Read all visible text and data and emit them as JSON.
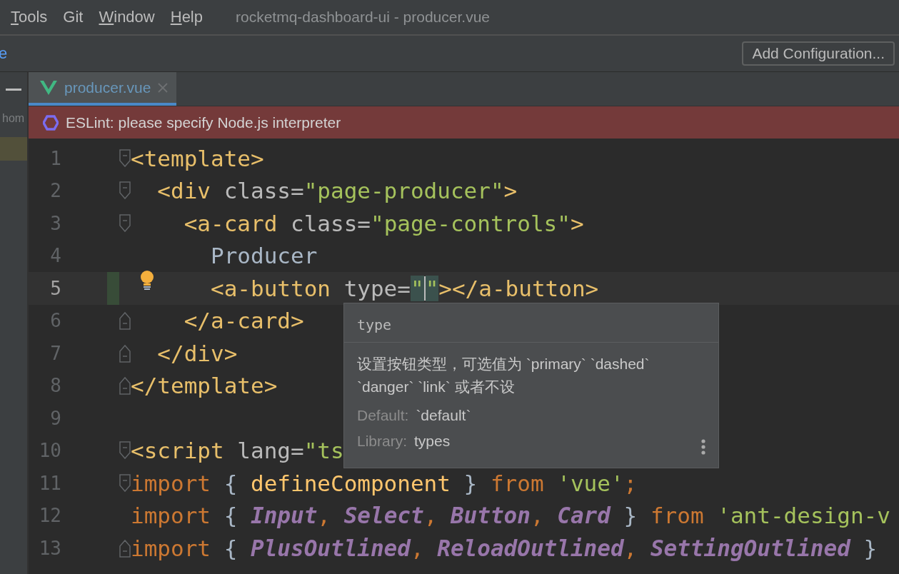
{
  "menu_bar": {
    "items": [
      {
        "label": "Tools",
        "underline_first": true
      },
      {
        "label": "Git",
        "underline_first": false
      },
      {
        "label": "Window",
        "underline_first": true
      },
      {
        "label": "Help",
        "underline_first": true
      }
    ],
    "title": "rocketmq-dashboard-ui - producer.vue"
  },
  "toolbar": {
    "breadcrumb": "e",
    "button": "Add Configuration..."
  },
  "side_panel": {
    "label": "hom"
  },
  "tabs": [
    {
      "label": "producer.vue",
      "selected": true
    }
  ],
  "banner": {
    "text": "ESLint: please specify Node.js interpreter"
  },
  "lines": [
    {
      "number": "1",
      "fold_start": true,
      "fold_end": false,
      "current": false,
      "changed": false,
      "bulb": false,
      "tokens": [
        {
          "text": "<template>",
          "kind": "tag"
        }
      ]
    },
    {
      "number": "2",
      "fold_start": true,
      "fold_end": false,
      "current": false,
      "changed": false,
      "bulb": false,
      "tokens": [
        {
          "text": "  <div",
          "kind": "tag"
        },
        {
          "text": " class=",
          "kind": "attr"
        },
        {
          "text": "\"page-producer\"",
          "kind": "string"
        },
        {
          "text": ">",
          "kind": "tag"
        }
      ]
    },
    {
      "number": "3",
      "fold_start": true,
      "fold_end": false,
      "current": false,
      "changed": false,
      "bulb": false,
      "tokens": [
        {
          "text": "    <a-card",
          "kind": "tag"
        },
        {
          "text": " class=",
          "kind": "attr"
        },
        {
          "text": "\"page-controls\"",
          "kind": "string"
        },
        {
          "text": ">",
          "kind": "tag"
        }
      ]
    },
    {
      "number": "4",
      "fold_start": false,
      "fold_end": false,
      "current": false,
      "changed": false,
      "bulb": false,
      "tokens": [
        {
          "text": "      Producer",
          "kind": "text"
        }
      ]
    },
    {
      "number": "5",
      "fold_start": false,
      "fold_end": false,
      "current": true,
      "changed": true,
      "bulb": true,
      "tokens": [
        {
          "text": "      <a-button",
          "kind": "tag"
        },
        {
          "text": " type=",
          "kind": "attr"
        },
        {
          "text": "\"",
          "kind": "string-match",
          "caret": true
        },
        {
          "text": "\"",
          "kind": "string-match",
          "caret": false
        },
        {
          "text": "></a-button>",
          "kind": "tag"
        }
      ]
    },
    {
      "number": "6",
      "fold_start": false,
      "fold_end": true,
      "current": false,
      "changed": false,
      "bulb": false,
      "tokens": [
        {
          "text": "    </a-card>",
          "kind": "tag"
        }
      ]
    },
    {
      "number": "7",
      "fold_start": false,
      "fold_end": true,
      "current": false,
      "changed": false,
      "bulb": false,
      "tokens": [
        {
          "text": "  </div>",
          "kind": "tag"
        }
      ]
    },
    {
      "number": "8",
      "fold_start": false,
      "fold_end": true,
      "current": false,
      "changed": false,
      "bulb": false,
      "tokens": [
        {
          "text": "</template>",
          "kind": "tag"
        }
      ]
    },
    {
      "number": "9",
      "fold_start": false,
      "fold_end": false,
      "current": false,
      "changed": false,
      "bulb": false
    },
    {
      "number": "10",
      "fold_start": true,
      "fold_end": false,
      "current": false,
      "changed": false,
      "bulb": false,
      "tokens": [
        {
          "text": "<script",
          "kind": "tag"
        },
        {
          "text": " lang=",
          "kind": "attr"
        },
        {
          "text": "\"ts",
          "kind": "string"
        }
      ]
    },
    {
      "number": "11",
      "fold_start": true,
      "fold_end": false,
      "current": false,
      "changed": false,
      "bulb": false,
      "tokens": [
        {
          "text": "import",
          "kind": "keyword"
        },
        {
          "text": " { ",
          "kind": "text"
        },
        {
          "text": "defineComponent",
          "kind": "function"
        },
        {
          "text": " } ",
          "kind": "text"
        },
        {
          "text": "from",
          "kind": "keyword"
        },
        {
          "text": " 'vue'",
          "kind": "string"
        },
        {
          "text": ";",
          "kind": "keyword"
        }
      ]
    },
    {
      "number": "12",
      "fold_start": false,
      "fold_end": false,
      "current": false,
      "changed": false,
      "bulb": false,
      "tokens": [
        {
          "text": "import",
          "kind": "keyword"
        },
        {
          "text": " { ",
          "kind": "text"
        },
        {
          "text": "Input",
          "kind": "ident"
        },
        {
          "text": ", ",
          "kind": "keyword"
        },
        {
          "text": "Select",
          "kind": "ident"
        },
        {
          "text": ", ",
          "kind": "keyword"
        },
        {
          "text": "Button",
          "kind": "ident"
        },
        {
          "text": ", ",
          "kind": "keyword"
        },
        {
          "text": "Card",
          "kind": "ident"
        },
        {
          "text": " } ",
          "kind": "text"
        },
        {
          "text": "from",
          "kind": "keyword"
        },
        {
          "text": " 'ant-design-v",
          "kind": "string"
        }
      ]
    },
    {
      "number": "13",
      "fold_start": false,
      "fold_end": true,
      "current": false,
      "changed": false,
      "bulb": false,
      "tokens": [
        {
          "text": "import",
          "kind": "keyword"
        },
        {
          "text": " { ",
          "kind": "text"
        },
        {
          "text": "PlusOutlined",
          "kind": "ident"
        },
        {
          "text": ", ",
          "kind": "keyword"
        },
        {
          "text": "ReloadOutlined",
          "kind": "ident"
        },
        {
          "text": ", ",
          "kind": "keyword"
        },
        {
          "text": "SettingOutlined",
          "kind": "ident"
        },
        {
          "text": " }",
          "kind": "text"
        }
      ]
    }
  ],
  "popup": {
    "title": "type",
    "description": "设置按钮类型，可选值为 `primary` `dashed` `danger` `link` 或者不设",
    "default_label": "Default:",
    "default_value": "`default`",
    "library_label": "Library:",
    "library_value": "types"
  }
}
